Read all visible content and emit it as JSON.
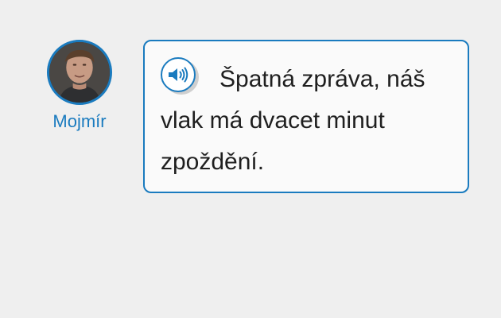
{
  "speaker": {
    "name": "Mojmír",
    "accent_color": "#1a7bbf"
  },
  "message": {
    "text": "Špatná zpráva, náš vlak má dvacet minut zpoždění.",
    "audio_icon": "speaker-volume-icon"
  },
  "colors": {
    "background": "#efefef",
    "bubble_border": "#1a7bbf",
    "bubble_bg": "#fafafa",
    "text": "#1f1f1f"
  }
}
